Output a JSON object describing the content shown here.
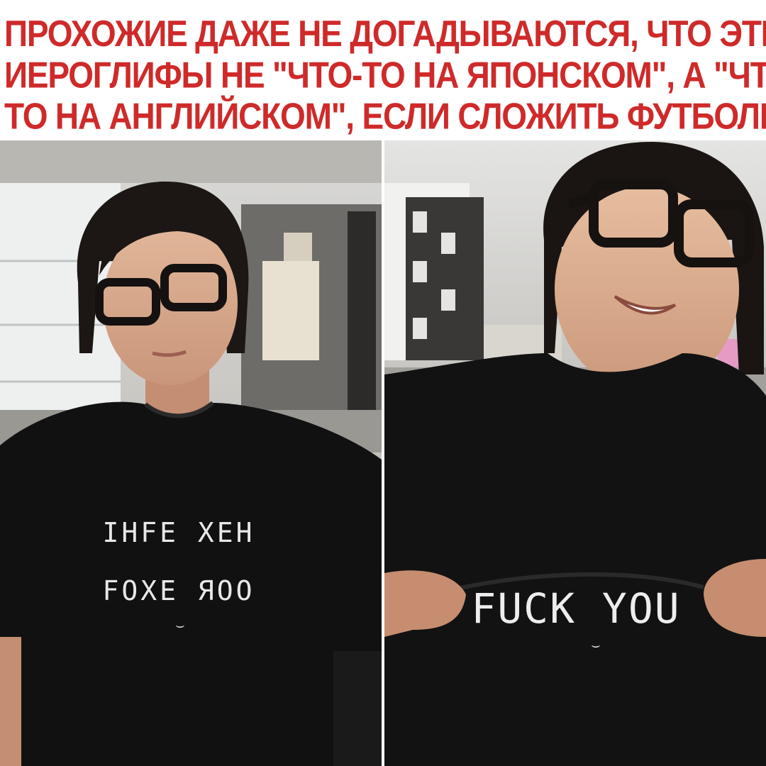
{
  "caption": {
    "lines": [
      "ПРОХОЖИЕ ДАЖЕ НЕ ДОГАДЫВАЮТСЯ, ЧТО ЭТИ",
      "ИЕРОГЛИФЫ НЕ \"ЧТО-ТО НА ЯПОНСКОМ\", А \"ЧТО-",
      "ТО НА АНГЛИЙСКОМ\", ЕСЛИ СЛОЖИТЬ ФУТБОЛКУ"
    ],
    "color": "#cf2a2a"
  },
  "photos": {
    "left": {
      "shirt_text_line1": "IHFE XEH",
      "shirt_text_line2": "FOXE ЯOO"
    },
    "right": {
      "shirt_text": "FUCK YOU"
    }
  }
}
